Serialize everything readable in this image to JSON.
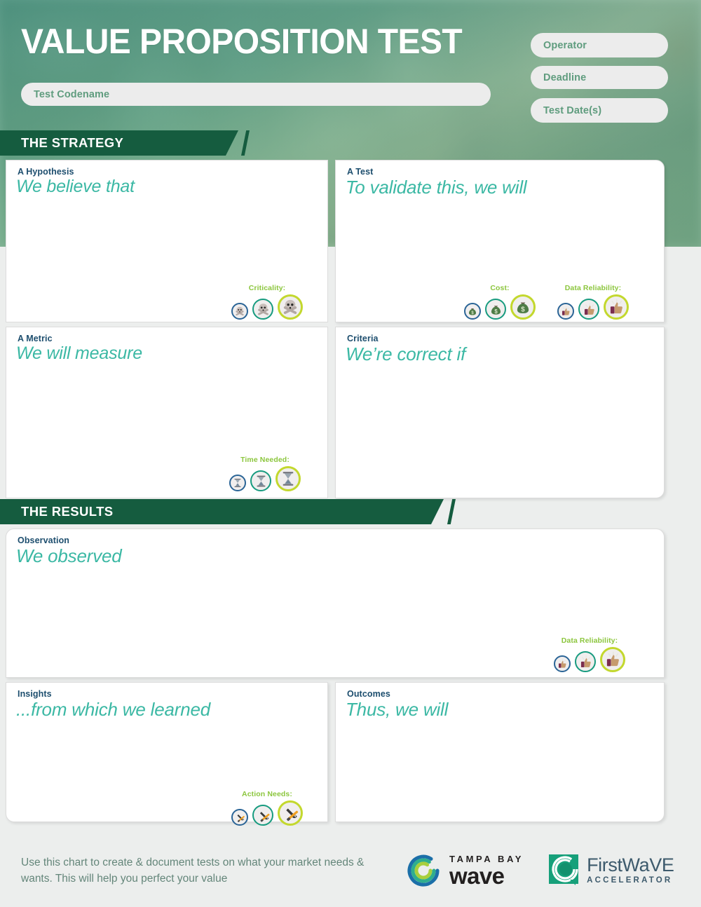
{
  "header": {
    "title": "VALUE PROPOSITION TEST",
    "fields": [
      {
        "name": "test-codename",
        "placeholder": "Test Codename",
        "value": ""
      },
      {
        "name": "operator",
        "placeholder": "Operator",
        "value": ""
      },
      {
        "name": "deadline",
        "placeholder": "Deadline",
        "value": ""
      },
      {
        "name": "test-dates",
        "placeholder": "Test Date(s)",
        "value": ""
      }
    ]
  },
  "sections": {
    "strategy": {
      "banner": "THE STRATEGY"
    },
    "results": {
      "banner": "THE RESULTS"
    }
  },
  "panels": {
    "hypothesis": {
      "label": "A Hypothesis",
      "prompt": "We believe that",
      "value": ""
    },
    "test": {
      "label": "A Test",
      "prompt": "To validate this, we will",
      "value": ""
    },
    "metric": {
      "label": "A Metric",
      "prompt": "We will measure",
      "value": ""
    },
    "criteria": {
      "label": "Criteria",
      "prompt": "We’re correct if",
      "value": ""
    },
    "observation": {
      "label": "Observation",
      "prompt": "We observed",
      "value": ""
    },
    "insights": {
      "label": "Insights",
      "prompt": "...from which we learned",
      "value": ""
    },
    "outcomes": {
      "label": "Outcomes",
      "prompt": "Thus, we will",
      "value": ""
    }
  },
  "ratings": {
    "criticality": {
      "label": "Criticality:",
      "icon": "skull-icon",
      "levels": [
        "low",
        "medium",
        "high"
      ]
    },
    "cost": {
      "label": "Cost:",
      "icon": "money-bag-icon",
      "levels": [
        "low",
        "medium",
        "high"
      ]
    },
    "data_reliability": {
      "label": "Data Reliability:",
      "icon": "thumbs-up-icon",
      "levels": [
        "low",
        "medium",
        "high"
      ]
    },
    "time_needed": {
      "label": "Time Needed:",
      "icon": "hourglass-icon",
      "levels": [
        "low",
        "medium",
        "high"
      ]
    },
    "action_needs": {
      "label": "Action Needs:",
      "icon": "tools-icon",
      "levels": [
        "low",
        "medium",
        "high"
      ]
    }
  },
  "footer": {
    "note": "Use this chart to create & document tests on what your market needs & wants. This will help you perfect your value",
    "logos": {
      "tampa_bay_wave": {
        "top": "TAMPA BAY",
        "bottom": "wave"
      },
      "firstwave": {
        "top": "FirstWaVE",
        "bottom": "ACCELERATOR"
      }
    }
  },
  "colors": {
    "banner_green": "#155c3f",
    "prompt_teal": "#3bb8a4",
    "label_navy": "#1d4e6e",
    "rating_label_green": "#8cc63e",
    "ring_low": "#2a6496",
    "ring_medium": "#179b7f",
    "ring_high": "#c3d82e",
    "page_bg": "#eceeed"
  }
}
